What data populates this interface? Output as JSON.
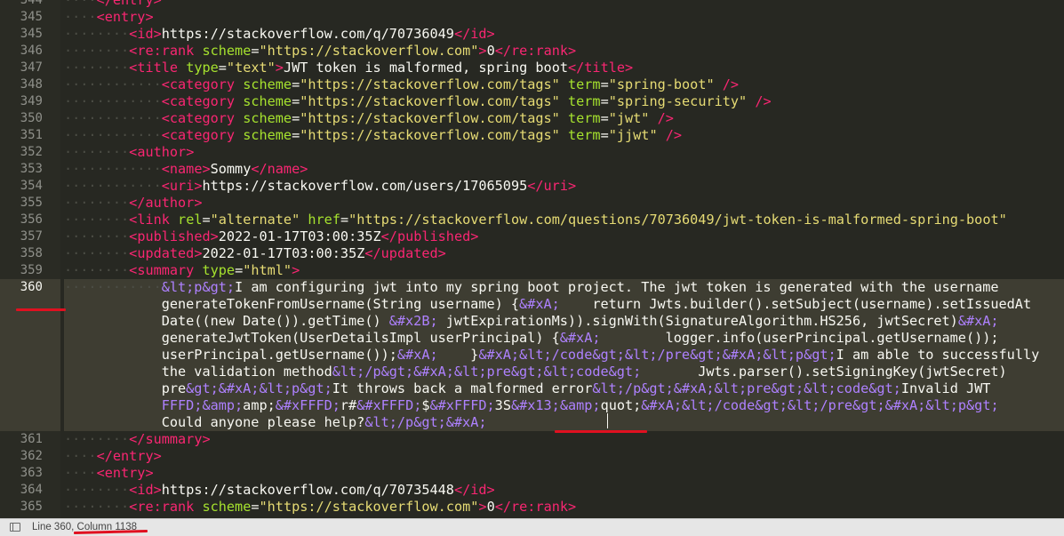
{
  "editor": {
    "current_line": 360,
    "lines": [
      {
        "n": "344",
        "tokens": [
          [
            "ind",
            "····"
          ],
          [
            "tag",
            "</"
          ],
          [
            "tag",
            "entry"
          ],
          [
            "tag",
            ">"
          ]
        ]
      },
      {
        "n": "345",
        "tokens": [
          [
            "ind",
            "····"
          ],
          [
            "tag",
            "<"
          ],
          [
            "tag",
            "entry"
          ],
          [
            "tag",
            ">"
          ]
        ]
      },
      {
        "n": "345",
        "tokens": [
          [
            "ind",
            "········"
          ],
          [
            "tag",
            "<"
          ],
          [
            "tag",
            "id"
          ],
          [
            "tag",
            ">"
          ],
          [
            "txt",
            "https://stackoverflow.com/q/70736049"
          ],
          [
            "tag",
            "</"
          ],
          [
            "tag",
            "id"
          ],
          [
            "tag",
            ">"
          ]
        ]
      },
      {
        "n": "346",
        "tokens": [
          [
            "ind",
            "········"
          ],
          [
            "tag",
            "<"
          ],
          [
            "tag",
            "re:rank"
          ],
          [
            "txt",
            " "
          ],
          [
            "attr",
            "scheme"
          ],
          [
            "p",
            "="
          ],
          [
            "str",
            "\"https://stackoverflow.com\""
          ],
          [
            "tag",
            ">"
          ],
          [
            "txt",
            "0"
          ],
          [
            "tag",
            "</"
          ],
          [
            "tag",
            "re:rank"
          ],
          [
            "tag",
            ">"
          ]
        ]
      },
      {
        "n": "347",
        "tokens": [
          [
            "ind",
            "········"
          ],
          [
            "tag",
            "<"
          ],
          [
            "tag",
            "title"
          ],
          [
            "txt",
            " "
          ],
          [
            "attr",
            "type"
          ],
          [
            "p",
            "="
          ],
          [
            "str",
            "\"text\""
          ],
          [
            "tag",
            ">"
          ],
          [
            "txt",
            "JWT token is malformed, spring boot"
          ],
          [
            "tag",
            "</"
          ],
          [
            "tag",
            "title"
          ],
          [
            "tag",
            ">"
          ]
        ]
      },
      {
        "n": "348",
        "tokens": [
          [
            "ind",
            "············"
          ],
          [
            "tag",
            "<"
          ],
          [
            "tag",
            "category"
          ],
          [
            "txt",
            " "
          ],
          [
            "attr",
            "scheme"
          ],
          [
            "p",
            "="
          ],
          [
            "str",
            "\"https://stackoverflow.com/tags\""
          ],
          [
            "txt",
            " "
          ],
          [
            "attr",
            "term"
          ],
          [
            "p",
            "="
          ],
          [
            "str",
            "\"spring-boot\""
          ],
          [
            "txt",
            " "
          ],
          [
            "tag",
            "/>"
          ]
        ]
      },
      {
        "n": "349",
        "tokens": [
          [
            "ind",
            "············"
          ],
          [
            "tag",
            "<"
          ],
          [
            "tag",
            "category"
          ],
          [
            "txt",
            " "
          ],
          [
            "attr",
            "scheme"
          ],
          [
            "p",
            "="
          ],
          [
            "str",
            "\"https://stackoverflow.com/tags\""
          ],
          [
            "txt",
            " "
          ],
          [
            "attr",
            "term"
          ],
          [
            "p",
            "="
          ],
          [
            "str",
            "\"spring-security\""
          ],
          [
            "txt",
            " "
          ],
          [
            "tag",
            "/>"
          ]
        ]
      },
      {
        "n": "350",
        "tokens": [
          [
            "ind",
            "············"
          ],
          [
            "tag",
            "<"
          ],
          [
            "tag",
            "category"
          ],
          [
            "txt",
            " "
          ],
          [
            "attr",
            "scheme"
          ],
          [
            "p",
            "="
          ],
          [
            "str",
            "\"https://stackoverflow.com/tags\""
          ],
          [
            "txt",
            " "
          ],
          [
            "attr",
            "term"
          ],
          [
            "p",
            "="
          ],
          [
            "str",
            "\"jwt\""
          ],
          [
            "txt",
            " "
          ],
          [
            "tag",
            "/>"
          ]
        ]
      },
      {
        "n": "351",
        "tokens": [
          [
            "ind",
            "············"
          ],
          [
            "tag",
            "<"
          ],
          [
            "tag",
            "category"
          ],
          [
            "txt",
            " "
          ],
          [
            "attr",
            "scheme"
          ],
          [
            "p",
            "="
          ],
          [
            "str",
            "\"https://stackoverflow.com/tags\""
          ],
          [
            "txt",
            " "
          ],
          [
            "attr",
            "term"
          ],
          [
            "p",
            "="
          ],
          [
            "str",
            "\"jjwt\""
          ],
          [
            "txt",
            " "
          ],
          [
            "tag",
            "/>"
          ]
        ]
      },
      {
        "n": "352",
        "tokens": [
          [
            "ind",
            "········"
          ],
          [
            "tag",
            "<"
          ],
          [
            "tag",
            "author"
          ],
          [
            "tag",
            ">"
          ]
        ]
      },
      {
        "n": "353",
        "tokens": [
          [
            "ind",
            "············"
          ],
          [
            "tag",
            "<"
          ],
          [
            "tag",
            "name"
          ],
          [
            "tag",
            ">"
          ],
          [
            "txt",
            "Sommy"
          ],
          [
            "tag",
            "</"
          ],
          [
            "tag",
            "name"
          ],
          [
            "tag",
            ">"
          ]
        ]
      },
      {
        "n": "354",
        "tokens": [
          [
            "ind",
            "············"
          ],
          [
            "tag",
            "<"
          ],
          [
            "tag",
            "uri"
          ],
          [
            "tag",
            ">"
          ],
          [
            "txt",
            "https://stackoverflow.com/users/17065095"
          ],
          [
            "tag",
            "</"
          ],
          [
            "tag",
            "uri"
          ],
          [
            "tag",
            ">"
          ]
        ]
      },
      {
        "n": "355",
        "tokens": [
          [
            "ind",
            "········"
          ],
          [
            "tag",
            "</"
          ],
          [
            "tag",
            "author"
          ],
          [
            "tag",
            ">"
          ]
        ]
      },
      {
        "n": "356",
        "tokens": [
          [
            "ind",
            "········"
          ],
          [
            "tag",
            "<"
          ],
          [
            "tag",
            "link"
          ],
          [
            "txt",
            " "
          ],
          [
            "attr",
            "rel"
          ],
          [
            "p",
            "="
          ],
          [
            "str",
            "\"alternate\""
          ],
          [
            "txt",
            " "
          ],
          [
            "attr",
            "href"
          ],
          [
            "p",
            "="
          ],
          [
            "str",
            "\"https://stackoverflow.com/questions/70736049/jwt-token-is-malformed-spring-boot\""
          ]
        ]
      },
      {
        "n": "357",
        "tokens": [
          [
            "ind",
            "········"
          ],
          [
            "tag",
            "<"
          ],
          [
            "tag",
            "published"
          ],
          [
            "tag",
            ">"
          ],
          [
            "txt",
            "2022-01-17T03:00:35Z"
          ],
          [
            "tag",
            "</"
          ],
          [
            "tag",
            "published"
          ],
          [
            "tag",
            ">"
          ]
        ]
      },
      {
        "n": "358",
        "tokens": [
          [
            "ind",
            "········"
          ],
          [
            "tag",
            "<"
          ],
          [
            "tag",
            "updated"
          ],
          [
            "tag",
            ">"
          ],
          [
            "txt",
            "2022-01-17T03:00:35Z"
          ],
          [
            "tag",
            "</"
          ],
          [
            "tag",
            "updated"
          ],
          [
            "tag",
            ">"
          ]
        ]
      },
      {
        "n": "359",
        "tokens": [
          [
            "ind",
            "········"
          ],
          [
            "tag",
            "<"
          ],
          [
            "tag",
            "summary"
          ],
          [
            "txt",
            " "
          ],
          [
            "attr",
            "type"
          ],
          [
            "p",
            "="
          ],
          [
            "str",
            "\"html\""
          ],
          [
            "tag",
            ">"
          ]
        ]
      },
      {
        "n": "360",
        "cur": true,
        "tokens": [
          [
            "ind",
            "············"
          ],
          [
            "ent",
            "&lt;p&gt;"
          ],
          [
            "txt",
            "I am configuring jwt into my spring boot project. The jwt token is generated with the username"
          ]
        ]
      },
      {
        "n": "",
        "cur": true,
        "tokens": [
          [
            "txt",
            "            generateTokenFromUsername(String username) {"
          ],
          [
            "ent",
            "&#xA;"
          ],
          [
            "txt",
            "    return Jwts.builder().setSubject(username).setIssuedAt"
          ]
        ]
      },
      {
        "n": "",
        "cur": true,
        "tokens": [
          [
            "txt",
            "            Date((new Date()).getTime() "
          ],
          [
            "ent",
            "&#x2B;"
          ],
          [
            "txt",
            " jwtExpirationMs)).signWith(SignatureAlgorithm.HS256, jwtSecret)"
          ],
          [
            "ent",
            "&#xA;"
          ]
        ]
      },
      {
        "n": "",
        "cur": true,
        "tokens": [
          [
            "txt",
            "            generateJwtToken(UserDetailsImpl userPrincipal) {"
          ],
          [
            "ent",
            "&#xA;"
          ],
          [
            "txt",
            "        logger.info(userPrincipal.getUsername());"
          ]
        ]
      },
      {
        "n": "",
        "cur": true,
        "tokens": [
          [
            "txt",
            "            userPrincipal.getUsername());"
          ],
          [
            "ent",
            "&#xA;"
          ],
          [
            "txt",
            "    }"
          ],
          [
            "ent",
            "&#xA;&lt;/code&gt;&lt;/pre&gt;&#xA;&lt;p&gt;"
          ],
          [
            "txt",
            "I am able to successfully"
          ]
        ]
      },
      {
        "n": "",
        "cur": true,
        "tokens": [
          [
            "txt",
            "            the validation method"
          ],
          [
            "ent",
            "&lt;/p&gt;&#xA;&lt;pre&gt;&lt;code&gt;"
          ],
          [
            "txt",
            "       Jwts.parser().setSigningKey(jwtSecret)"
          ]
        ]
      },
      {
        "n": "",
        "cur": true,
        "tokens": [
          [
            "txt",
            "            pre"
          ],
          [
            "ent",
            "&gt;&#xA;&lt;p&gt;"
          ],
          [
            "txt",
            "It throws back a malformed error"
          ],
          [
            "ent",
            "&lt;/p&gt;&#xA;&lt;pre&gt;&lt;code&gt;"
          ],
          [
            "txt",
            "Invalid JWT"
          ]
        ]
      },
      {
        "n": "",
        "cur": true,
        "tokens": [
          [
            "ent",
            "            FFFD;&amp;"
          ],
          [
            "txt",
            "amp;"
          ],
          [
            "ent",
            "&#xFFFD;"
          ],
          [
            "txt",
            "r#"
          ],
          [
            "ent",
            "&#xFFFD;"
          ],
          [
            "txt",
            "$"
          ],
          [
            "ent",
            "&#xFFFD;"
          ],
          [
            "txt",
            "3S"
          ],
          [
            "ent",
            "&#x13;&amp;"
          ],
          [
            "txt",
            "quot;"
          ],
          [
            "ent",
            "&#xA;&lt;/code&gt;&lt;/pre&gt;&#xA;&lt;p&gt;"
          ]
        ]
      },
      {
        "n": "",
        "cur": true,
        "tokens": [
          [
            "txt",
            "            Could anyone please help?"
          ],
          [
            "ent",
            "&lt;/p&gt;&#xA;"
          ]
        ]
      },
      {
        "n": "361",
        "tokens": [
          [
            "ind",
            "········"
          ],
          [
            "tag",
            "</"
          ],
          [
            "tag",
            "summary"
          ],
          [
            "tag",
            ">"
          ]
        ]
      },
      {
        "n": "362",
        "tokens": [
          [
            "ind",
            "····"
          ],
          [
            "tag",
            "</"
          ],
          [
            "tag",
            "entry"
          ],
          [
            "tag",
            ">"
          ]
        ]
      },
      {
        "n": "363",
        "tokens": [
          [
            "ind",
            "····"
          ],
          [
            "tag",
            "<"
          ],
          [
            "tag",
            "entry"
          ],
          [
            "tag",
            ">"
          ]
        ]
      },
      {
        "n": "364",
        "tokens": [
          [
            "ind",
            "········"
          ],
          [
            "tag",
            "<"
          ],
          [
            "tag",
            "id"
          ],
          [
            "tag",
            ">"
          ],
          [
            "txt",
            "https://stackoverflow.com/q/70735448"
          ],
          [
            "tag",
            "</"
          ],
          [
            "tag",
            "id"
          ],
          [
            "tag",
            ">"
          ]
        ]
      },
      {
        "n": "365",
        "tokens": [
          [
            "ind",
            "········"
          ],
          [
            "tag",
            "<"
          ],
          [
            "tag",
            "re:rank"
          ],
          [
            "txt",
            " "
          ],
          [
            "attr",
            "scheme"
          ],
          [
            "p",
            "="
          ],
          [
            "str",
            "\"https://stackoverflow.com\""
          ],
          [
            "tag",
            ">"
          ],
          [
            "txt",
            "0"
          ],
          [
            "tag",
            "</"
          ],
          [
            "tag",
            "re:rank"
          ],
          [
            "tag",
            ">"
          ]
        ]
      }
    ]
  },
  "statusbar": {
    "position_text": "Line 360, Column 1138"
  },
  "colors": {
    "background": "#272822",
    "tag": "#f92672",
    "attribute": "#a6e22e",
    "string": "#e6db74",
    "entity": "#ae81ff",
    "text": "#f8f8f2",
    "annotation": "#e01020"
  },
  "icons": {
    "statusbar_toggle": "sidebar-toggle-icon"
  }
}
